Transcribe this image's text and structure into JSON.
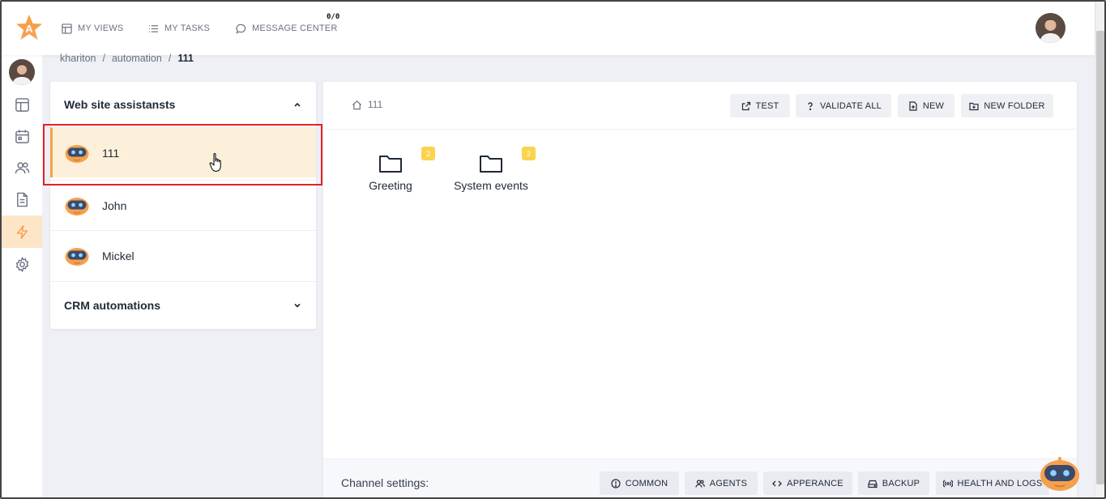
{
  "topbar": {
    "nav": [
      {
        "label": "MY VIEWS",
        "icon": "views-icon"
      },
      {
        "label": "MY TASKS",
        "icon": "tasks-icon"
      },
      {
        "label": "MESSAGE CENTER",
        "icon": "message-icon"
      }
    ],
    "message_count": "0/0"
  },
  "breadcrumb": {
    "items": [
      "khariton",
      "/",
      "automation",
      "/"
    ],
    "current": "111"
  },
  "left_panel": {
    "section1": {
      "title": "Web site assistansts",
      "expanded": true
    },
    "assistants": [
      {
        "name": "111",
        "active": true
      },
      {
        "name": "John",
        "active": false
      },
      {
        "name": "Mickel",
        "active": false
      }
    ],
    "section2": {
      "title": "CRM automations",
      "expanded": false
    }
  },
  "main": {
    "path": "111",
    "toolbar": {
      "test": "TEST",
      "validate": "VALIDATE ALL",
      "new": "NEW",
      "new_folder": "NEW FOLDER"
    },
    "folders": [
      {
        "name": "Greeting",
        "count": "2"
      },
      {
        "name": "System events",
        "count": "2"
      }
    ],
    "footer": {
      "label": "Channel settings:",
      "buttons": {
        "common": "COMMON",
        "agents": "AGENTS",
        "appearance": "APPERANCE",
        "backup": "BACKUP",
        "health": "HEALTH AND LOGS"
      }
    }
  },
  "colors": {
    "accent": "#f6a04d",
    "highlight": "#e02424",
    "badge": "#fcd34d",
    "active_row": "#fdf0da"
  }
}
